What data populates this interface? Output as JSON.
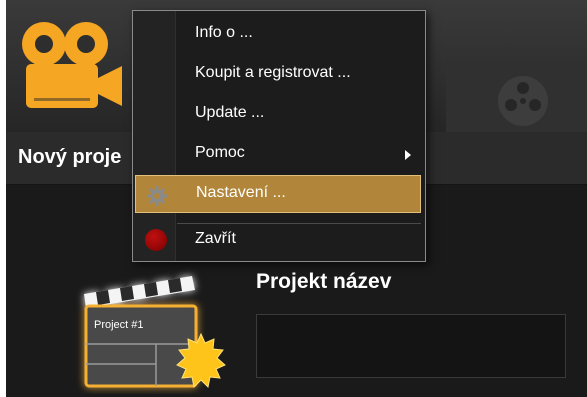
{
  "header": {
    "project_tab_title": "Nový proje"
  },
  "menu": {
    "items": [
      {
        "label": "Info o ...",
        "has_submenu": false,
        "selected": false,
        "icon": ""
      },
      {
        "label": "Koupit a registrovat ...",
        "has_submenu": false,
        "selected": false,
        "icon": ""
      },
      {
        "label": "Update ...",
        "has_submenu": false,
        "selected": false,
        "icon": ""
      },
      {
        "label": "Pomoc",
        "has_submenu": true,
        "selected": false,
        "icon": ""
      },
      {
        "label": "Nastavení ...",
        "has_submenu": false,
        "selected": true,
        "icon": "gear-icon"
      },
      {
        "label": "Zavřít",
        "has_submenu": false,
        "selected": false,
        "icon": "red-circle-icon"
      }
    ]
  },
  "project": {
    "name_label": "Projekt název",
    "name_value": "",
    "thumbnail_caption": "Project #1"
  },
  "colors": {
    "accent": "#f5a623",
    "menu_selected": "#b1863a",
    "close_red": "#a00000"
  }
}
